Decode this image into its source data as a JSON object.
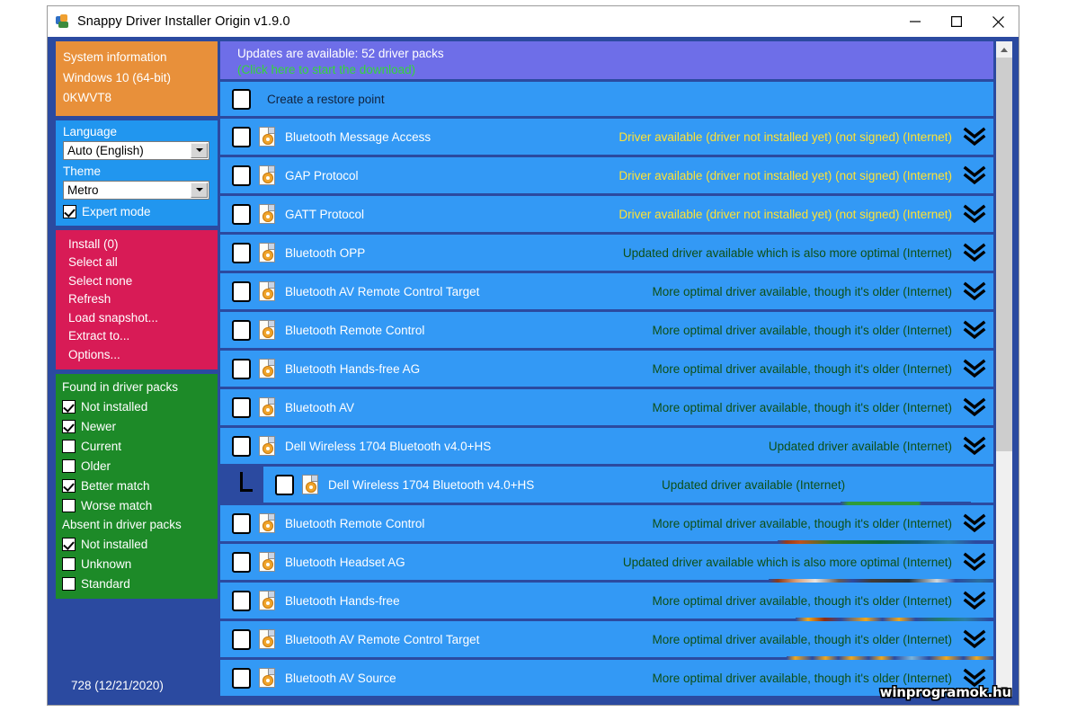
{
  "window": {
    "title": "Snappy Driver Installer Origin v1.9.0",
    "icon": "app-icon",
    "controls": {
      "minimize": "minimize-icon",
      "maximize": "maximize-icon",
      "close": "close-icon"
    }
  },
  "sidebar": {
    "system_information": {
      "heading": "System information",
      "os": "Windows 10 (64-bit)",
      "model": "0KWVT8"
    },
    "settings": {
      "language_label": "Language",
      "language_value": "Auto (English)",
      "theme_label": "Theme",
      "theme_value": "Metro",
      "expert_mode_label": "Expert mode",
      "expert_mode_checked": true
    },
    "actions": [
      {
        "label": "Install (0)"
      },
      {
        "label": "Select all"
      },
      {
        "label": "Select none"
      },
      {
        "label": "Refresh"
      },
      {
        "label": "Load snapshot..."
      },
      {
        "label": "Extract to..."
      },
      {
        "label": "Options..."
      }
    ],
    "filters": {
      "found_heading": "Found in driver packs",
      "found_items": [
        {
          "label": "Not installed",
          "checked": true
        },
        {
          "label": "Newer",
          "checked": true
        },
        {
          "label": "Current",
          "checked": false
        },
        {
          "label": "Older",
          "checked": false
        },
        {
          "label": "Better match",
          "checked": true
        },
        {
          "label": "Worse match",
          "checked": false
        }
      ],
      "absent_heading": "Absent in driver packs",
      "absent_items": [
        {
          "label": "Not installed",
          "checked": true
        },
        {
          "label": "Unknown",
          "checked": false
        },
        {
          "label": "Standard",
          "checked": false
        }
      ]
    },
    "status": "728 (12/21/2020)"
  },
  "main": {
    "update_banner": {
      "line1": "Updates are available: 52 driver packs",
      "line2": "(Click here to start the download)"
    },
    "restore_row": {
      "label": "Create a restore point",
      "checked": false
    },
    "rows": [
      {
        "name": "Bluetooth Message Access",
        "status": "Driver available (driver not installed yet) (not signed) (Internet)",
        "status_color": "yellow",
        "checked": false,
        "child": false,
        "bleed": null
      },
      {
        "name": "GAP Protocol",
        "status": "Driver available (driver not installed yet) (not signed) (Internet)",
        "status_color": "yellow",
        "checked": false,
        "child": false,
        "bleed": null
      },
      {
        "name": "GATT Protocol",
        "status": "Driver available (driver not installed yet) (not signed) (Internet)",
        "status_color": "yellow",
        "checked": false,
        "child": false,
        "bleed": null
      },
      {
        "name": "Bluetooth OPP",
        "status": "Updated driver available which is also more optimal (Internet)",
        "status_color": "green",
        "checked": false,
        "child": false,
        "bleed": null
      },
      {
        "name": "Bluetooth AV Remote Control Target",
        "status": "More optimal driver available, though it's older (Internet)",
        "status_color": "green",
        "checked": false,
        "child": false,
        "bleed": null
      },
      {
        "name": "Bluetooth Remote Control",
        "status": "More optimal driver available, though it's older (Internet)",
        "status_color": "green",
        "checked": false,
        "child": false,
        "bleed": null
      },
      {
        "name": "Bluetooth Hands-free AG",
        "status": "More optimal driver available, though it's older (Internet)",
        "status_color": "green",
        "checked": false,
        "child": false,
        "bleed": null
      },
      {
        "name": "Bluetooth AV",
        "status": "More optimal driver available, though it's older (Internet)",
        "status_color": "green",
        "checked": false,
        "child": false,
        "bleed": null
      },
      {
        "name": "Dell Wireless 1704 Bluetooth v4.0+HS",
        "status": "Updated driver available (Internet)",
        "status_color": "green",
        "checked": false,
        "child": false,
        "bleed": null
      },
      {
        "name": "Dell Wireless 1704 Bluetooth v4.0+HS",
        "status": "Updated driver available (Internet)",
        "status_color": "green",
        "checked": false,
        "child": true,
        "bleed": "green"
      },
      {
        "name": "Bluetooth Remote Control",
        "status": "More optimal driver available, though it's older (Internet)",
        "status_color": "green",
        "checked": false,
        "child": false,
        "bleed": "mixed1"
      },
      {
        "name": "Bluetooth Headset AG",
        "status": "Updated driver available which is also more optimal (Internet)",
        "status_color": "green",
        "checked": false,
        "child": false,
        "bleed": "mixed2"
      },
      {
        "name": "Bluetooth Hands-free",
        "status": "More optimal driver available, though it's older (Internet)",
        "status_color": "green",
        "checked": false,
        "child": false,
        "bleed": "mixed3"
      },
      {
        "name": "Bluetooth AV Remote Control Target",
        "status": "More optimal driver available, though it's older (Internet)",
        "status_color": "green",
        "checked": false,
        "child": false,
        "bleed": "mixed4"
      },
      {
        "name": "Bluetooth AV Source",
        "status": "More optimal driver available, though it's older (Internet)",
        "status_color": "green",
        "checked": false,
        "child": false,
        "bleed": null
      }
    ],
    "expand_icon": "chevron-double-down-icon"
  },
  "scrollbar": {
    "up_icon": "scroll-up-icon",
    "down_icon": "scroll-down-icon"
  },
  "watermark": "winprogramok.hu",
  "colors": {
    "sysinfo_bg": "#e8903a",
    "settings_bg": "#2196ef",
    "actions_bg": "#d81b56",
    "filters_bg": "#1d8a28",
    "window_bg": "#2b4aa0",
    "row_bg": "#3399f5",
    "banner_bg": "#6e6ee8",
    "status_green": "#0d4f17",
    "status_yellow": "#ffe234",
    "banner_link": "#34d63a"
  }
}
